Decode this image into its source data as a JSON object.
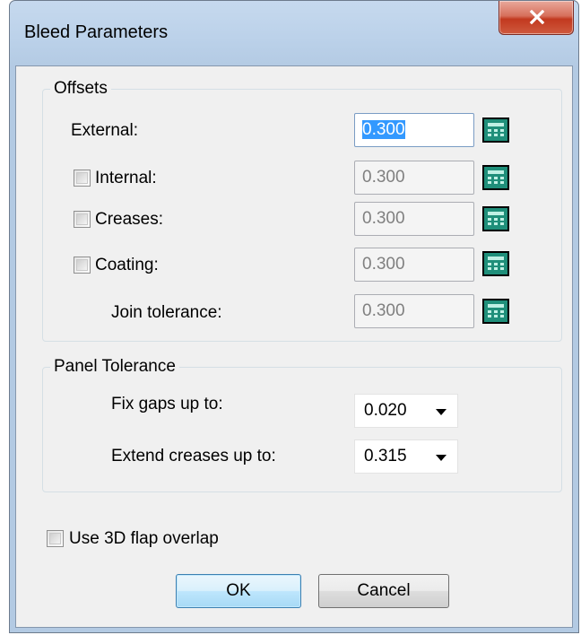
{
  "window": {
    "title": "Bleed Parameters"
  },
  "offsets": {
    "legend": "Offsets",
    "external": {
      "label": "External:",
      "value": "0.300",
      "checkbox": false
    },
    "internal": {
      "label": "Internal:",
      "value": "0.300",
      "checked": false
    },
    "creases": {
      "label": "Creases:",
      "value": "0.300",
      "checked": false
    },
    "coating": {
      "label": "Coating:",
      "value": "0.300",
      "checked": false
    },
    "join_tolerance": {
      "label": "Join tolerance:",
      "value": "0.300"
    }
  },
  "panel_tolerance": {
    "legend": "Panel Tolerance",
    "fix_gaps": {
      "label": "Fix gaps up to:",
      "value": "0.020"
    },
    "extend_creases": {
      "label": "Extend creases up to:",
      "value": "0.315"
    }
  },
  "use_3d_flap_overlap": {
    "label": "Use 3D flap overlap",
    "checked": false
  },
  "buttons": {
    "ok": "OK",
    "cancel": "Cancel"
  },
  "icons": {
    "close": "close-icon",
    "calculator": "calculator-icon",
    "dropdown": "chevron-down-icon"
  },
  "colors": {
    "titlebar": "#bcd2ea",
    "close_button": "#c2391f",
    "calculator": "#1f8f7a",
    "selection": "#3399ff",
    "client": "#f0f0f0"
  }
}
